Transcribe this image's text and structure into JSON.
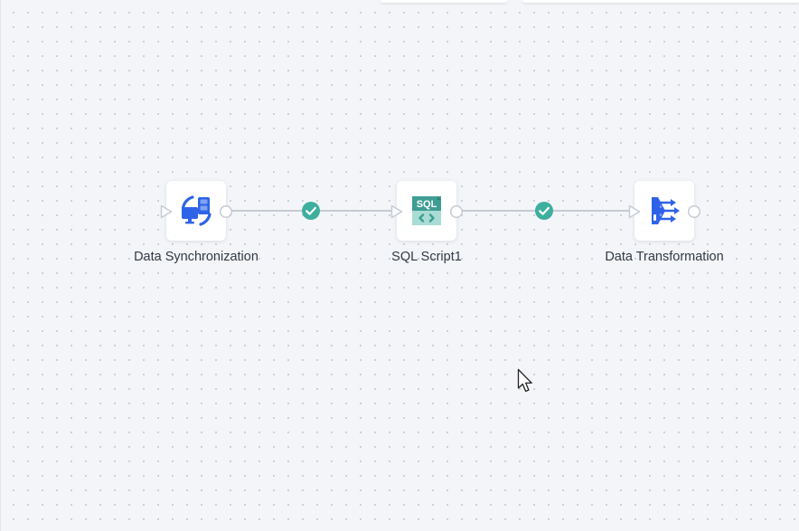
{
  "workflow": {
    "nodes": [
      {
        "label": "Data Synchronization",
        "icon": "data-sync-icon"
      },
      {
        "label": "SQL Script1",
        "icon": "sql-script-icon",
        "badge_text": "SQL"
      },
      {
        "label": "Data Transformation",
        "icon": "data-transform-icon"
      }
    ],
    "edges": [
      {
        "status": "success",
        "status_icon": "check-circle-icon"
      },
      {
        "status": "success",
        "status_icon": "check-circle-icon"
      }
    ]
  },
  "colors": {
    "canvas_bg": "#f3f5f8",
    "dot_grid": "#c9ced6",
    "edge_line": "#c5cbd4",
    "success": "#3eaf9f",
    "icon_blue": "#2e62e8",
    "icon_blue_light": "#7fa3f3",
    "sql_green": "#3f9d93",
    "sql_green_light": "#a9dcd4",
    "label_text": "#333a45"
  }
}
